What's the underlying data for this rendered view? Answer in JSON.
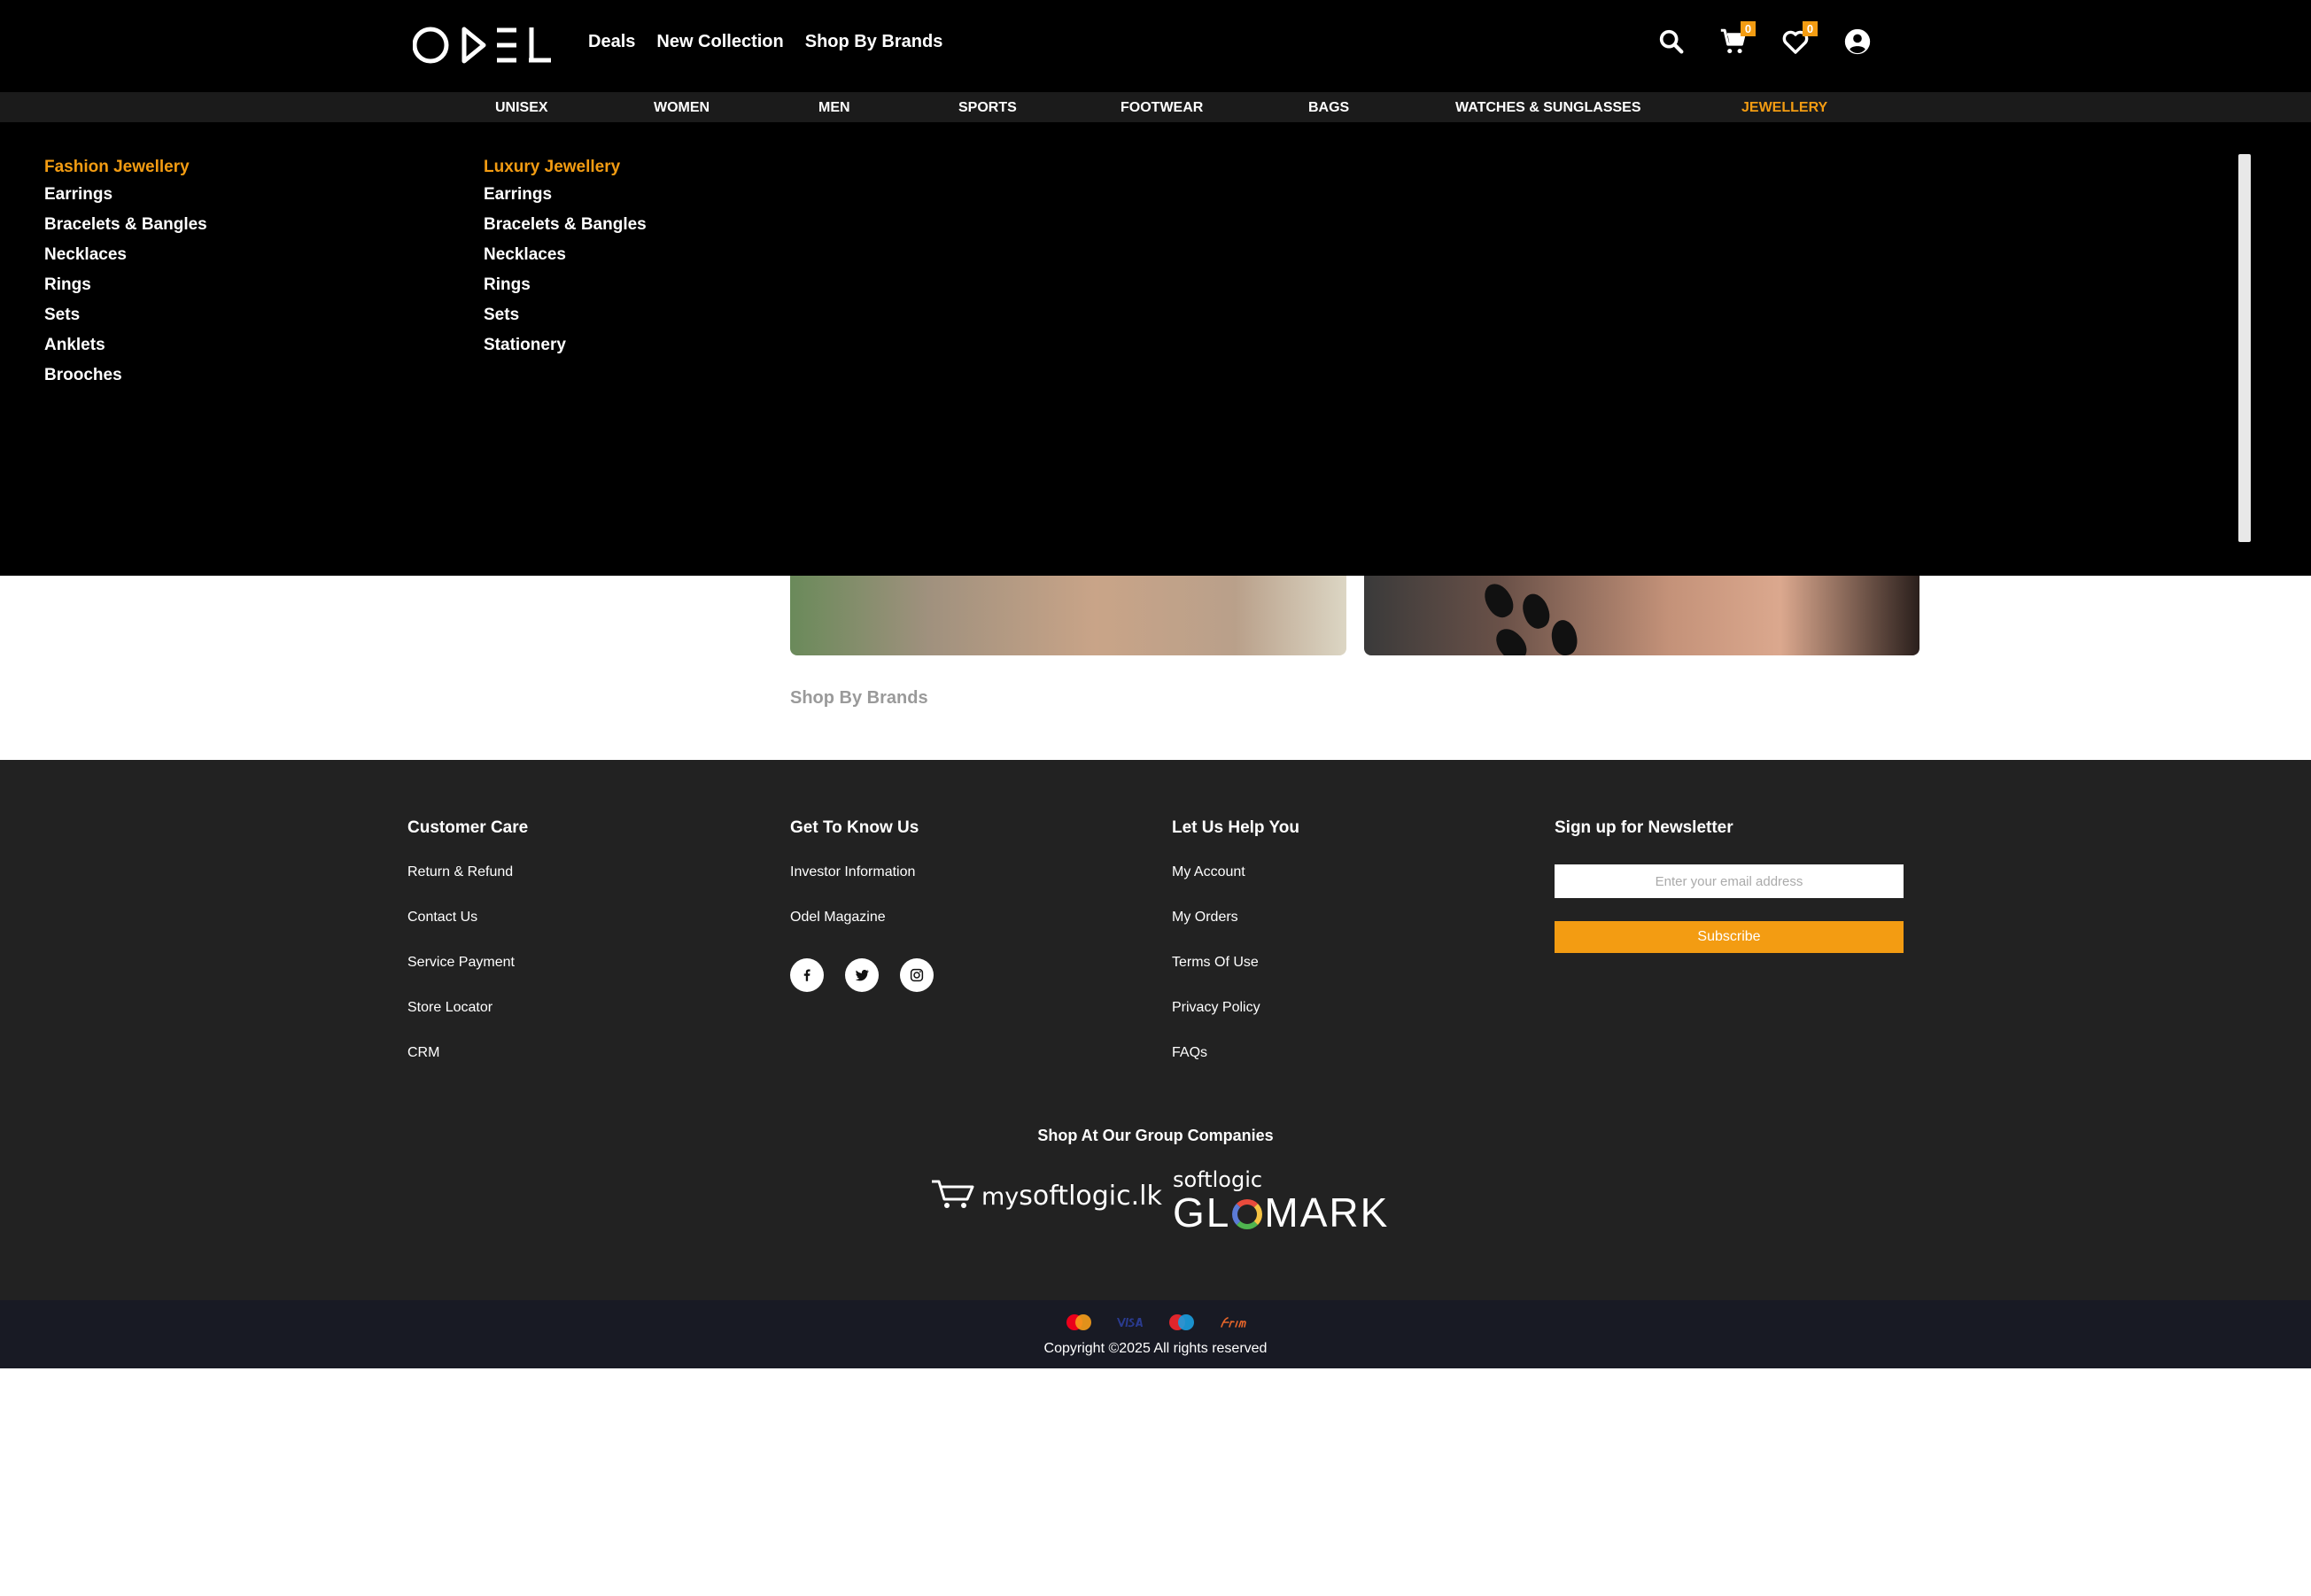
{
  "brand": {
    "logo_text": "ODEL"
  },
  "topnav": {
    "items": [
      "Deals",
      "New Collection",
      "Shop By Brands"
    ]
  },
  "header": {
    "cart_count": "0",
    "wishlist_count": "0"
  },
  "categories": [
    "UNISEX",
    "WOMEN",
    "MEN",
    "SPORTS",
    "FOOTWEAR",
    "BAGS",
    "WATCHES & SUNGLASSES",
    "JEWELLERY"
  ],
  "active_category": "JEWELLERY",
  "megamenu": {
    "columns": [
      {
        "heading": "Fashion Jewellery",
        "items": [
          "Earrings",
          "Bracelets & Bangles",
          "Necklaces",
          "Rings",
          "Sets",
          "Anklets",
          "Brooches"
        ]
      },
      {
        "heading": "Luxury Jewellery",
        "items": [
          "Earrings",
          "Bracelets & Bangles",
          "Necklaces",
          "Rings",
          "Sets",
          "Stationery"
        ]
      }
    ]
  },
  "content": {
    "shop_by_brands": "Shop By Brands"
  },
  "footer": {
    "customer_care": {
      "title": "Customer Care",
      "links": [
        "Return & Refund",
        "Contact Us",
        "Service Payment",
        "Store Locator",
        "CRM"
      ]
    },
    "get_to_know": {
      "title": "Get To Know Us",
      "links": [
        "Investor Information",
        "Odel Magazine"
      ]
    },
    "help": {
      "title": "Let Us Help You",
      "links": [
        "My Account",
        "My Orders",
        "Terms Of Use",
        "Privacy Policy",
        "FAQs"
      ]
    },
    "newsletter": {
      "title": "Sign up for Newsletter",
      "placeholder": "Enter your email address",
      "button": "Subscribe"
    },
    "group_title": "Shop At Our Group Companies",
    "group_logos": {
      "mysoftlogic_my": "my",
      "mysoftlogic_main": "softlogic",
      "mysoftlogic_tld": ".lk",
      "glomark_top": "softlogic",
      "glomark_a": "GL",
      "glomark_b": "MARK"
    },
    "copyright": "Copyright ©2025 All rights reserved"
  },
  "colors": {
    "accent": "#f39c12",
    "header_bg": "#000000",
    "footer_bg": "#222222",
    "bottom_bg": "#181a24"
  },
  "icons": [
    "search-icon",
    "cart-icon",
    "heart-icon",
    "user-icon",
    "facebook-icon",
    "twitter-icon",
    "instagram-icon",
    "mastercard-icon",
    "visa-icon",
    "maestro-icon",
    "frimi-icon"
  ]
}
